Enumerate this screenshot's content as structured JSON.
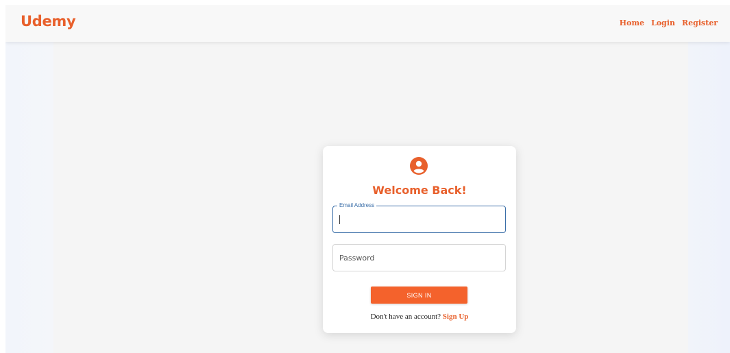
{
  "navbar": {
    "brand": "Udemy",
    "links": [
      {
        "label": "Home"
      },
      {
        "label": "Login"
      },
      {
        "label": "Register"
      }
    ]
  },
  "login_card": {
    "icon": "user-circle-icon",
    "title": "Welcome Back!",
    "email_field": {
      "label": "Email Address",
      "value": ""
    },
    "password_field": {
      "placeholder": "Password",
      "value": ""
    },
    "submit_label": "SIGN IN",
    "signup_prompt": "Don't have an account?",
    "signup_link": "Sign Up"
  },
  "colors": {
    "accent": "#e8602c",
    "button": "#f4622c",
    "focus_border": "#3a6ea8"
  }
}
